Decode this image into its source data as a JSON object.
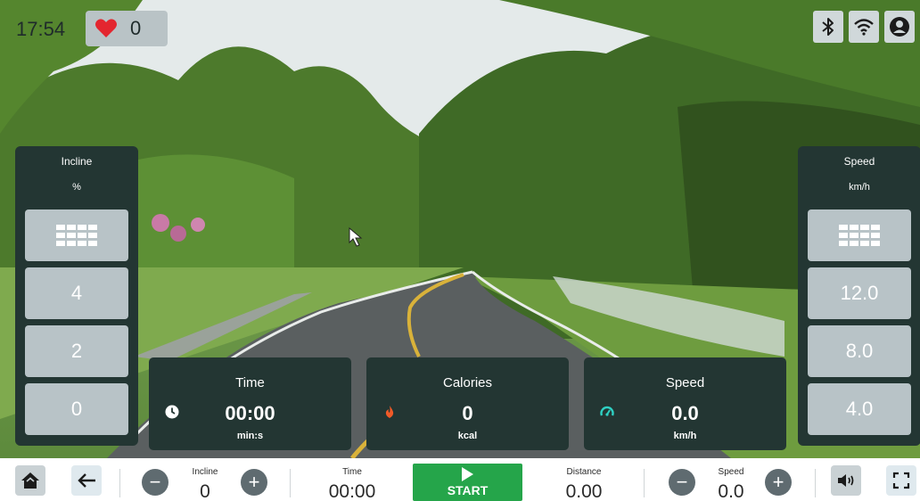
{
  "status_bar": {
    "time": "17:54",
    "heart_rate": "0",
    "icons": [
      "bluetooth-icon",
      "wifi-icon",
      "user-account-icon"
    ]
  },
  "incline_panel": {
    "title": "Incline",
    "unit": "%",
    "presets": [
      "4",
      "2",
      "0"
    ],
    "keypad_icon": "keypad-icon"
  },
  "speed_panel": {
    "title": "Speed",
    "unit": "km/h",
    "presets": [
      "12.0",
      "8.0",
      "4.0"
    ],
    "keypad_icon": "keypad-icon"
  },
  "cards": {
    "time": {
      "title": "Time",
      "value": "00:00",
      "unit": "min:s",
      "icon": "clock-icon"
    },
    "calories": {
      "title": "Calories",
      "value": "0",
      "unit": "kcal",
      "icon": "flame-icon"
    },
    "speed": {
      "title": "Speed",
      "value": "0.0",
      "unit": "km/h",
      "icon": "speedometer-icon"
    }
  },
  "bottom_bar": {
    "incline": {
      "label": "Incline",
      "value": "0"
    },
    "time": {
      "label": "Time",
      "value": "00:00"
    },
    "start_label": "START",
    "distance": {
      "label": "Distance",
      "value": "0.00"
    },
    "speed": {
      "label": "Speed",
      "value": "0.0"
    },
    "minus": "−",
    "plus": "+"
  },
  "colors": {
    "panel": "#233633",
    "button": "#b8c3c7",
    "start": "#25a54a",
    "heart": "#e3262f",
    "flame": "#f05a28",
    "speedometer": "#2fd1c4"
  }
}
